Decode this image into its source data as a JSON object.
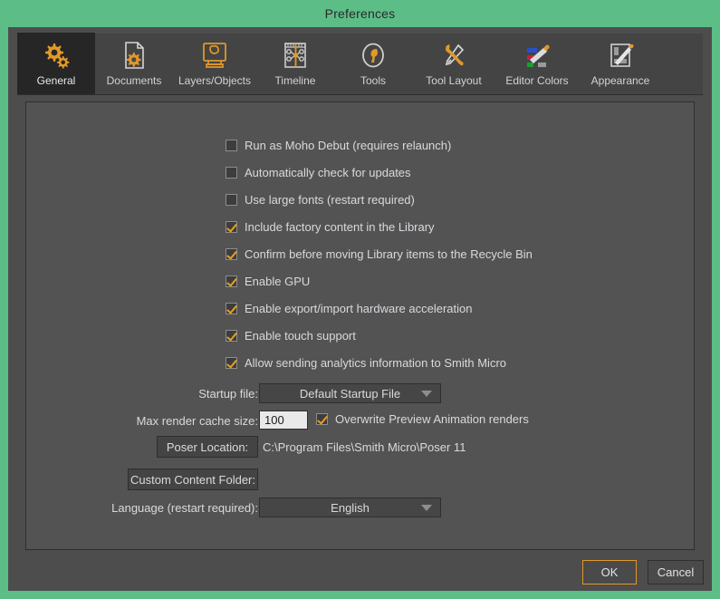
{
  "window": {
    "title": "Preferences",
    "frame_color": "#5cbd87",
    "accent_color": "#e8a020"
  },
  "tabs": [
    {
      "label": "General",
      "icon": "gears-icon",
      "active": true
    },
    {
      "label": "Documents",
      "icon": "document-gear-icon",
      "active": false
    },
    {
      "label": "Layers/Objects",
      "icon": "layers-monitor-icon",
      "active": false
    },
    {
      "label": "Timeline",
      "icon": "timeline-icon",
      "active": false
    },
    {
      "label": "Tools",
      "icon": "wrench-circle-icon",
      "active": false
    },
    {
      "label": "Tool Layout",
      "icon": "wrench-screwdriver-icon",
      "active": false
    },
    {
      "label": "Editor Colors",
      "icon": "color-swatch-pen-icon",
      "active": false
    },
    {
      "label": "Appearance",
      "icon": "appearance-pen-icon",
      "active": false
    }
  ],
  "general": {
    "checkboxes": [
      {
        "label": "Run as Moho Debut (requires relaunch)",
        "checked": false
      },
      {
        "label": "Automatically check for updates",
        "checked": false
      },
      {
        "label": "Use large fonts (restart required)",
        "checked": false
      },
      {
        "label": "Include factory content in the Library",
        "checked": true
      },
      {
        "label": "Confirm before moving Library items to the Recycle Bin",
        "checked": true
      },
      {
        "label": "Enable GPU",
        "checked": true
      },
      {
        "label": "Enable export/import hardware acceleration",
        "checked": true
      },
      {
        "label": "Enable touch support",
        "checked": true
      },
      {
        "label": "Allow sending analytics information to Smith Micro",
        "checked": true
      }
    ],
    "startup_file": {
      "label": "Startup file:",
      "value": "Default Startup File"
    },
    "max_render_cache": {
      "label": "Max render cache size:",
      "value": "100"
    },
    "overwrite_preview": {
      "label": "Overwrite Preview Animation renders",
      "checked": true
    },
    "poser_location": {
      "button_label": "Poser Location:",
      "path": "C:\\Program Files\\Smith Micro\\Poser 11"
    },
    "custom_content_folder": {
      "button_label": "Custom Content Folder:",
      "path": ""
    },
    "language": {
      "label": "Language (restart required):",
      "value": "English"
    }
  },
  "footer": {
    "ok_label": "OK",
    "cancel_label": "Cancel"
  }
}
